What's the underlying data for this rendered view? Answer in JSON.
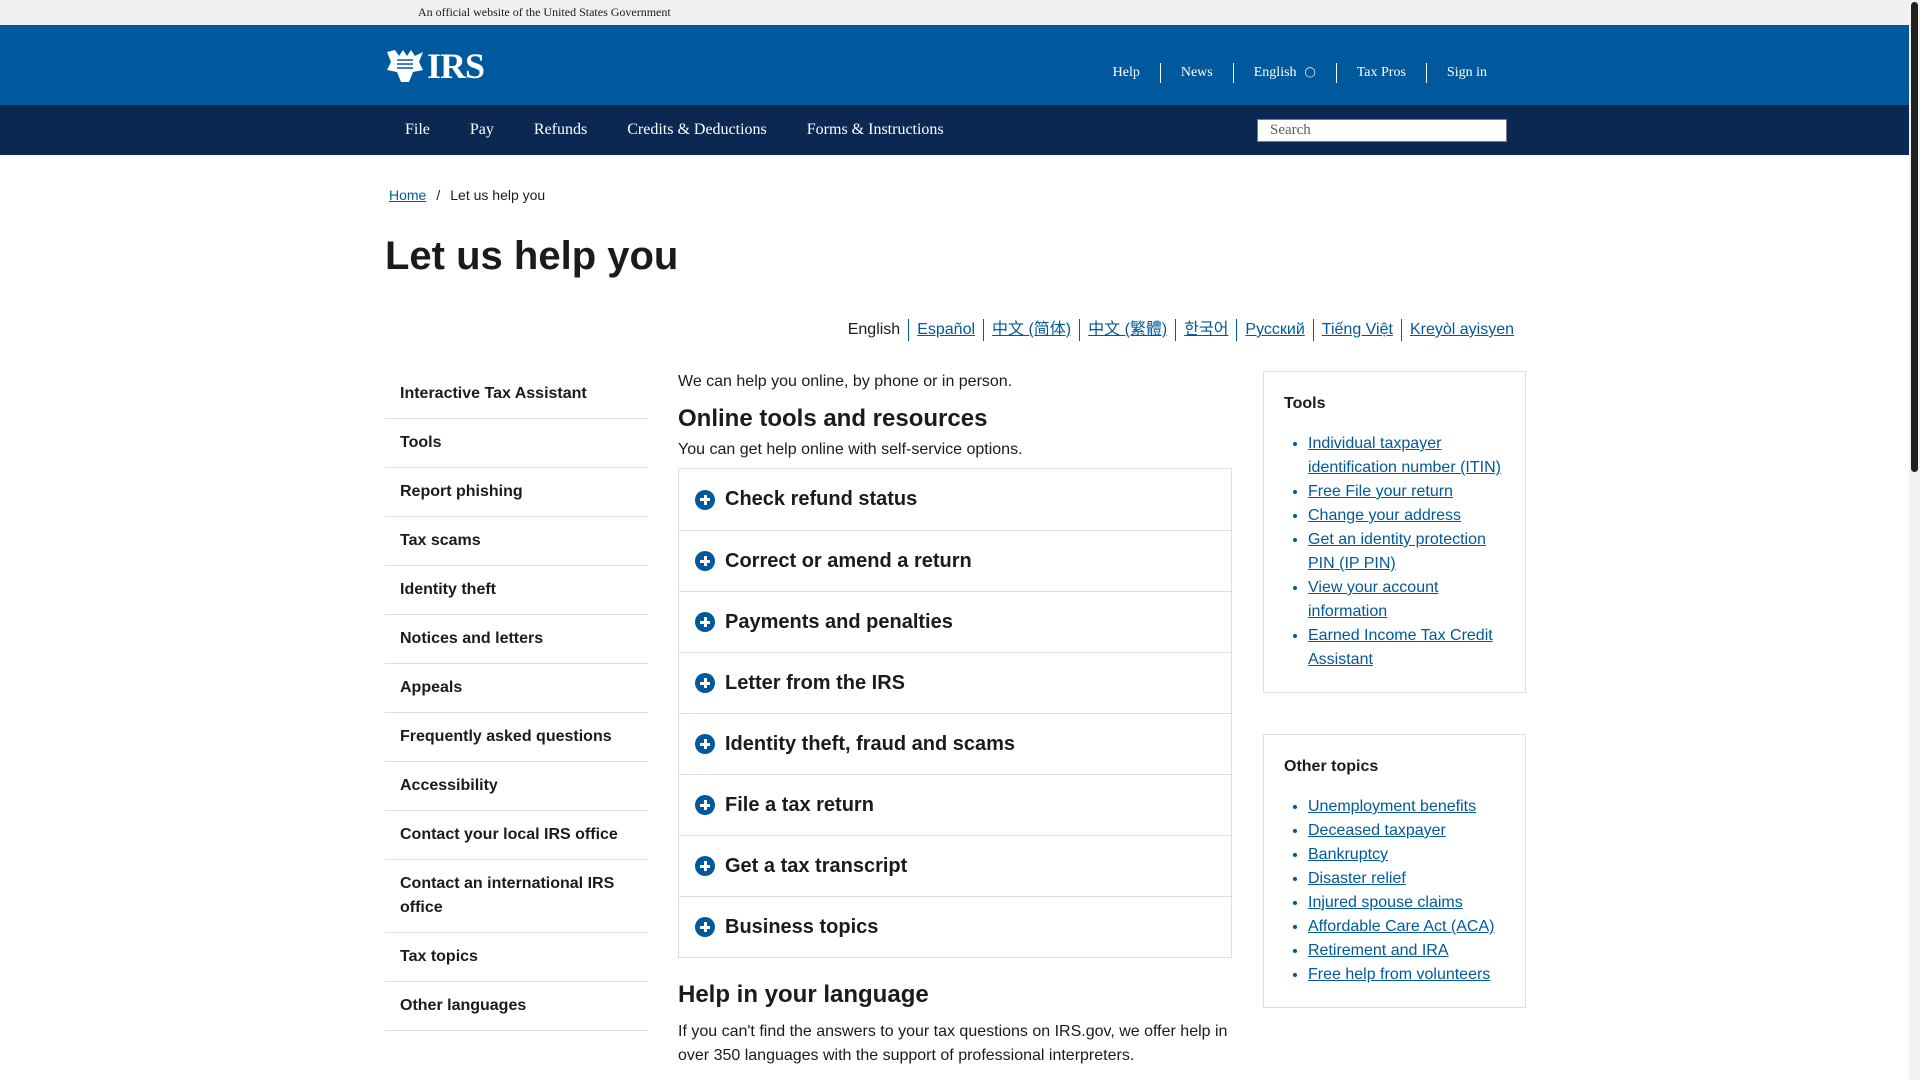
{
  "gov_banner": "An official website of the United States Government",
  "logo": {
    "text": "IRS"
  },
  "top_links": [
    "Help",
    "News",
    "English",
    "Tax Pros",
    "Sign in"
  ],
  "nav": [
    "File",
    "Pay",
    "Refunds",
    "Credits & Deductions",
    "Forms & Instructions"
  ],
  "search": {
    "placeholder": "Search"
  },
  "breadcrumb": {
    "home": "Home",
    "sep": "/",
    "current": "Let us help you"
  },
  "page_title": "Let us help you",
  "languages": [
    "English",
    "Español",
    "中文 (简体)",
    "中文 (繁體)",
    "한국어",
    "Русский",
    "Tiếng Việt",
    "Kreyòl ayisyen"
  ],
  "sidenav": [
    "Interactive Tax Assistant",
    "Tools",
    "Report phishing",
    "Tax scams",
    "Identity theft",
    "Notices and letters",
    "Appeals",
    "Frequently asked questions",
    "Accessibility",
    "Contact your local IRS office",
    "Contact an international IRS office",
    "Tax topics",
    "Other languages"
  ],
  "main": {
    "intro": "We can help you online, by phone or in person.",
    "online_title": "Online tools and resources",
    "online_sub": "You can get help online with self-service options.",
    "accordion": [
      "Check refund status",
      "Correct or amend a return",
      "Payments and penalties",
      "Letter from the IRS",
      "Identity theft, fraud and scams",
      "File a tax return",
      "Get a tax transcript",
      "Business topics"
    ],
    "lang_title": "Help in your language",
    "lang_text": "If you can't find the answers to your tax questions on IRS.gov, we offer help in over 350 languages with the support of professional interpreters."
  },
  "tools": {
    "title": "Tools",
    "items": [
      "Individual taxpayer identification number (ITIN)",
      "Free File your return",
      "Change your address",
      "Get an identity protection PIN (IP PIN)",
      "View your account information",
      "Earned Income Tax Credit Assistant"
    ]
  },
  "other_topics": {
    "title": "Other topics",
    "items": [
      "Unemployment benefits",
      "Deceased taxpayer",
      "Bankruptcy",
      "Disaster relief",
      "Injured spouse claims",
      "Affordable Care Act (ACA)",
      "Retirement and IRA",
      "Free help from volunteers"
    ]
  }
}
